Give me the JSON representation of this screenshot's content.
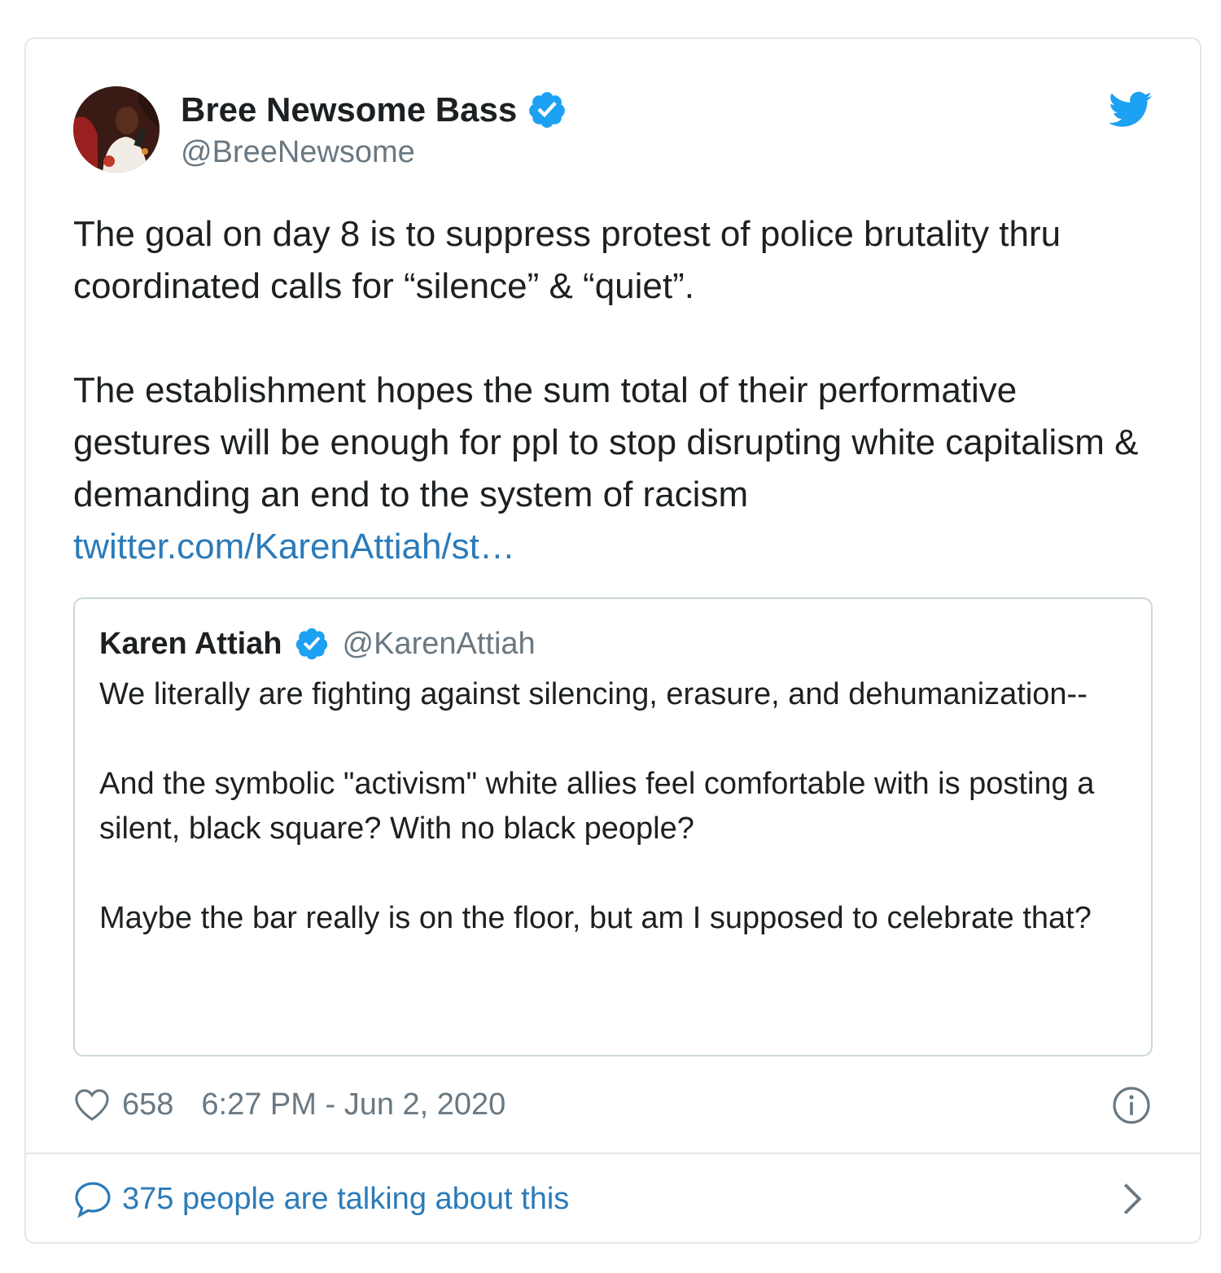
{
  "tweet": {
    "author_name": "Bree Newsome Bass",
    "author_handle": "@BreeNewsome",
    "text_p1": "The goal on day 8 is to suppress protest of police brutality thru coordinated calls for “silence” & “quiet”.",
    "text_p2": "The establishment hopes the sum total of their performative gestures will be enough for ppl to stop disrupting white capitalism & demanding an end to the system of racism",
    "link_text": "twitter.com/KarenAttiah/st…",
    "likes": "658",
    "timestamp": "6:27 PM - Jun 2, 2020",
    "talking": "375 people are talking about this"
  },
  "quoted": {
    "author_name": "Karen Attiah",
    "author_handle": "@KarenAttiah",
    "p1": "We literally are fighting against silencing, erasure, and dehumanization--",
    "p2": "And the symbolic \"activism\" white allies feel comfortable with is posting a silent, black square? With no black people?",
    "p3": "Maybe the bar really is on the floor, but am I supposed to celebrate that?"
  },
  "colors": {
    "link": "#2b7bb9",
    "verified": "#1da1f2",
    "muted": "#697882",
    "border": "#e1e8ed"
  },
  "icons": [
    "avatar",
    "verified-badge-icon",
    "twitter-bird-icon",
    "heart-icon",
    "info-icon",
    "speech-bubble-icon",
    "chevron-right-icon"
  ]
}
